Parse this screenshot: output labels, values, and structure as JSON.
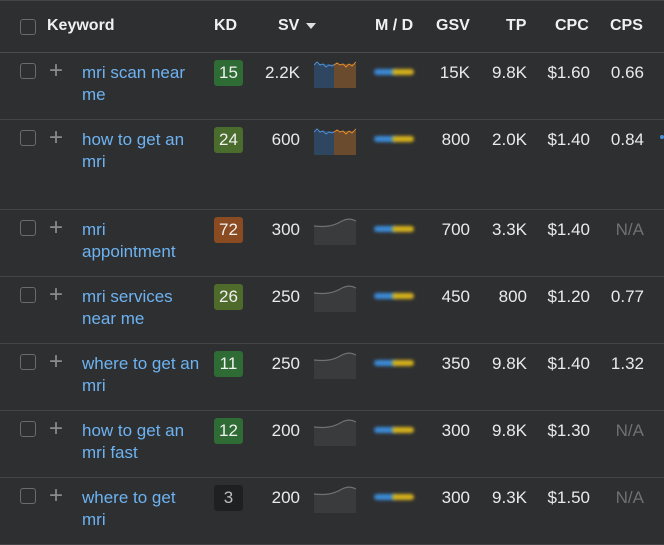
{
  "header": {
    "keyword": "Keyword",
    "kd": "KD",
    "sv": "SV",
    "md": "M / D",
    "gsv": "GSV",
    "tp": "TP",
    "cpc": "CPC",
    "cps": "CPS",
    "sort_icon": "sort-desc-icon"
  },
  "colors": {
    "keyword_link": "#6db3f2",
    "kd_easy": "#2f6b34",
    "kd_medium": "#4f6b2c",
    "kd_hard": "#8a4a22",
    "kd_very_easy": "#1f2022",
    "md_mobile": "#3b8bd8",
    "md_desktop": "#d6b21c"
  },
  "rows": [
    {
      "keyword": "mri scan near me",
      "kd": "15",
      "kd_color": "#2f6b34",
      "sv": "2.2K",
      "trend": "colored",
      "gsv": "15K",
      "tp": "9.8K",
      "cpc": "$1.60",
      "cps": "0.66",
      "cps_na": false
    },
    {
      "keyword": "how to get an mri",
      "kd": "24",
      "kd_color": "#4a6c2c",
      "sv": "600",
      "trend": "colored",
      "gsv": "800",
      "tp": "2.0K",
      "cpc": "$1.40",
      "cps": "0.84",
      "cps_na": false
    },
    {
      "keyword": "mri appointment",
      "kd": "72",
      "kd_color": "#8a4a22",
      "sv": "300",
      "trend": "gray",
      "gsv": "700",
      "tp": "3.3K",
      "cpc": "$1.40",
      "cps": "N/A",
      "cps_na": true
    },
    {
      "keyword": "mri services near me",
      "kd": "26",
      "kd_color": "#4f6b2c",
      "sv": "250",
      "trend": "gray",
      "gsv": "450",
      "tp": "800",
      "cpc": "$1.20",
      "cps": "0.77",
      "cps_na": false
    },
    {
      "keyword": "where to get an mri",
      "kd": "11",
      "kd_color": "#2f6b34",
      "sv": "250",
      "trend": "gray",
      "gsv": "350",
      "tp": "9.8K",
      "cpc": "$1.40",
      "cps": "1.32",
      "cps_na": false
    },
    {
      "keyword": "how to get an mri fast",
      "kd": "12",
      "kd_color": "#2f6b34",
      "sv": "200",
      "trend": "gray",
      "gsv": "300",
      "tp": "9.8K",
      "cpc": "$1.30",
      "cps": "N/A",
      "cps_na": true
    },
    {
      "keyword": "where to get mri",
      "kd": "3",
      "kd_color": "#1f2022",
      "sv": "200",
      "trend": "gray",
      "gsv": "300",
      "tp": "9.3K",
      "cpc": "$1.50",
      "cps": "N/A",
      "cps_na": true
    }
  ]
}
